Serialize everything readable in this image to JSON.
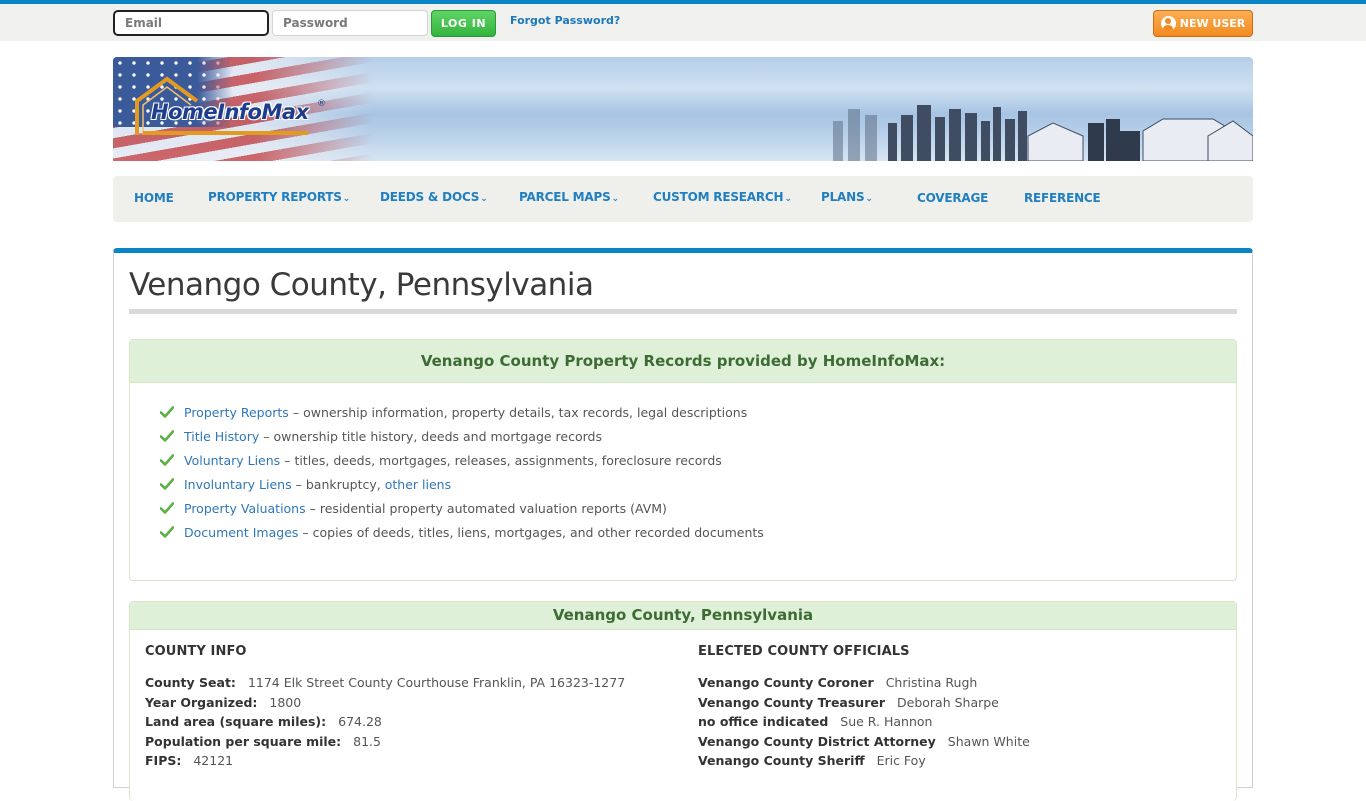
{
  "topbar": {
    "email_placeholder": "Email",
    "password_placeholder": "Password",
    "login_label": "LOG IN",
    "forgot_label": "Forgot Password?",
    "new_user_label": "NEW USER"
  },
  "brand": {
    "name": "HomeInfoMax",
    "registered_mark": "®"
  },
  "nav": {
    "items": [
      {
        "label": "HOME",
        "dropdown": false
      },
      {
        "label": "PROPERTY REPORTS",
        "dropdown": true
      },
      {
        "label": "DEEDS & DOCS",
        "dropdown": true
      },
      {
        "label": "PARCEL MAPS",
        "dropdown": true
      },
      {
        "label": "CUSTOM RESEARCH",
        "dropdown": true
      },
      {
        "label": "PLANS",
        "dropdown": true
      },
      {
        "label": "COVERAGE",
        "dropdown": false
      },
      {
        "label": "REFERENCE",
        "dropdown": false
      }
    ],
    "chevron": "⌄"
  },
  "page": {
    "title": "Venango County, Pennsylvania"
  },
  "records_panel": {
    "heading": "Venango County Property Records provided by HomeInfoMax:",
    "items": [
      {
        "link": "Property Reports",
        "sep": "–",
        "text": "ownership information, property details, tax records, legal descriptions"
      },
      {
        "link": "Title History",
        "sep": "–",
        "text": "ownership title history, deeds and mortgage records"
      },
      {
        "link": "Voluntary Liens",
        "sep": "–",
        "text": "titles, deeds, mortgages, releases, assignments, foreclosure records"
      },
      {
        "link": "Involuntary Liens",
        "sep": "–",
        "text": "bankruptcy, ",
        "link2": "other liens"
      },
      {
        "link": "Property Valuations",
        "sep": "–",
        "text": "residential property automated valuation reports (AVM)"
      },
      {
        "link": "Document Images",
        "sep": "–",
        "text": "copies of deeds, titles, liens, mortgages, and other recorded documents"
      }
    ]
  },
  "county_panel": {
    "heading": "Venango County, Pennsylvania",
    "county_info": {
      "title": "COUNTY INFO",
      "rows": [
        {
          "label": "County Seat:",
          "value": "1174 Elk Street County Courthouse Franklin, PA 16323-1277"
        },
        {
          "label": "Year Organized:",
          "value": "1800"
        },
        {
          "label": "Land area (square miles):",
          "value": "674.28"
        },
        {
          "label": "Population per square mile:",
          "value": "81.5"
        },
        {
          "label": "FIPS:",
          "value": "42121"
        }
      ]
    },
    "officials": {
      "title": "ELECTED COUNTY OFFICIALS",
      "rows": [
        {
          "label": "Venango County Coroner",
          "value": "Christina Rugh"
        },
        {
          "label": "Venango County Treasurer",
          "value": "Deborah Sharpe"
        },
        {
          "label": "no office indicated",
          "value": "Sue R. Hannon"
        },
        {
          "label": "Venango County District Attorney",
          "value": "Shawn White"
        },
        {
          "label": "Venango County Sheriff",
          "value": "Eric Foy"
        }
      ]
    }
  },
  "colors": {
    "accent_blue": "#0b84c6",
    "link_blue": "#2f77b9",
    "login_green": "#34b43e",
    "new_user_orange": "#f28b1e",
    "panel_green_bg": "#dff0d8",
    "panel_green_text": "#3d6b34"
  }
}
